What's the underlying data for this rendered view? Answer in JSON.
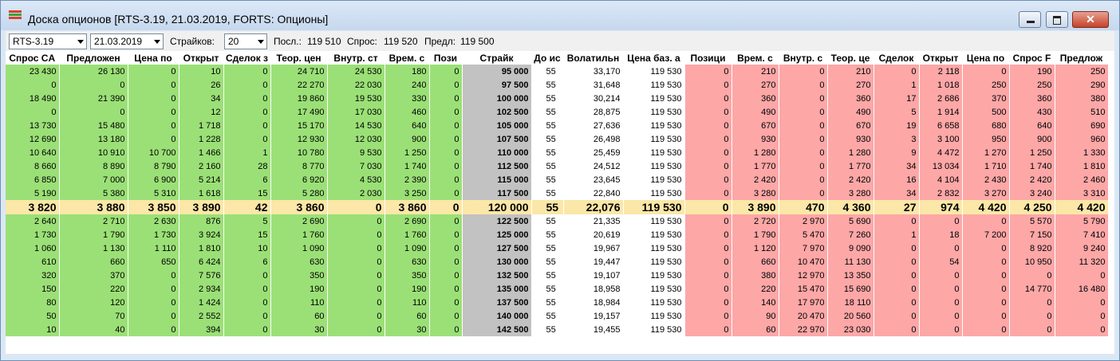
{
  "window": {
    "title": "Доска опционов [RTS-3.19, 21.03.2019, FORTS: Опционы]",
    "controls": {
      "minimize": "",
      "maximize": "",
      "close": "✕"
    }
  },
  "toolbar": {
    "instrument": "RTS-3.19",
    "expiration": "21.03.2019",
    "strikes_label": "Страйков:",
    "strikes_value": "20",
    "last_label": "Посл.:",
    "last_value": "119 510",
    "bid_label": "Спрос:",
    "bid_value": "119 520",
    "ask_label": "Предл:",
    "ask_value": "119 500"
  },
  "colors": {
    "call_bg": "#9be077",
    "put_bg": "#fda7a7",
    "strike_bg": "#c2c2c2",
    "atm_bg": "#fbe7a7"
  },
  "columns": [
    "Спрос CA",
    "Предложен",
    "Цена по",
    "Открыт",
    "Сделок з",
    "Теор. цен",
    "Внутр. ст",
    "Врем. с",
    "Пози",
    "Страйк",
    "До ис",
    "Волатильн",
    "Цена баз. а",
    "Позици",
    "Врем. с",
    "Внутр. с",
    "Теор. це",
    "Сделок",
    "Открыт",
    "Цена по",
    "Спрос F",
    "Предлож"
  ],
  "rows": [
    [
      "23 430",
      "26 130",
      "0",
      "10",
      "0",
      "24 710",
      "24 530",
      "180",
      "0",
      "95 000",
      "55",
      "33,170",
      "119 530",
      "0",
      "210",
      "0",
      "210",
      "0",
      "2 118",
      "0",
      "190",
      "250"
    ],
    [
      "0",
      "0",
      "0",
      "26",
      "0",
      "22 270",
      "22 030",
      "240",
      "0",
      "97 500",
      "55",
      "31,648",
      "119 530",
      "0",
      "270",
      "0",
      "270",
      "1",
      "1 018",
      "250",
      "250",
      "290"
    ],
    [
      "18 490",
      "21 390",
      "0",
      "34",
      "0",
      "19 860",
      "19 530",
      "330",
      "0",
      "100 000",
      "55",
      "30,214",
      "119 530",
      "0",
      "360",
      "0",
      "360",
      "17",
      "2 686",
      "370",
      "360",
      "380"
    ],
    [
      "0",
      "0",
      "0",
      "12",
      "0",
      "17 490",
      "17 030",
      "460",
      "0",
      "102 500",
      "55",
      "28,875",
      "119 530",
      "0",
      "490",
      "0",
      "490",
      "5",
      "1 914",
      "500",
      "430",
      "510"
    ],
    [
      "13 730",
      "15 480",
      "0",
      "1 718",
      "0",
      "15 170",
      "14 530",
      "640",
      "0",
      "105 000",
      "55",
      "27,636",
      "119 530",
      "0",
      "670",
      "0",
      "670",
      "19",
      "6 658",
      "680",
      "640",
      "690"
    ],
    [
      "12 690",
      "13 180",
      "0",
      "1 228",
      "0",
      "12 930",
      "12 030",
      "900",
      "0",
      "107 500",
      "55",
      "26,498",
      "119 530",
      "0",
      "930",
      "0",
      "930",
      "3",
      "3 100",
      "950",
      "900",
      "960"
    ],
    [
      "10 640",
      "10 910",
      "10 700",
      "1 466",
      "1",
      "10 780",
      "9 530",
      "1 250",
      "0",
      "110 000",
      "55",
      "25,459",
      "119 530",
      "0",
      "1 280",
      "0",
      "1 280",
      "9",
      "4 472",
      "1 270",
      "1 250",
      "1 330"
    ],
    [
      "8 660",
      "8 890",
      "8 790",
      "2 160",
      "28",
      "8 770",
      "7 030",
      "1 740",
      "0",
      "112 500",
      "55",
      "24,512",
      "119 530",
      "0",
      "1 770",
      "0",
      "1 770",
      "34",
      "13 034",
      "1 710",
      "1 740",
      "1 810"
    ],
    [
      "6 850",
      "7 000",
      "6 900",
      "5 214",
      "6",
      "6 920",
      "4 530",
      "2 390",
      "0",
      "115 000",
      "55",
      "23,645",
      "119 530",
      "0",
      "2 420",
      "0",
      "2 420",
      "16",
      "4 104",
      "2 430",
      "2 420",
      "2 460"
    ],
    [
      "5 190",
      "5 380",
      "5 310",
      "1 618",
      "15",
      "5 280",
      "2 030",
      "3 250",
      "0",
      "117 500",
      "55",
      "22,840",
      "119 530",
      "0",
      "3 280",
      "0",
      "3 280",
      "34",
      "2 832",
      "3 270",
      "3 240",
      "3 310"
    ],
    [
      "3 820",
      "3 880",
      "3 850",
      "3 890",
      "42",
      "3 860",
      "0",
      "3 860",
      "0",
      "120 000",
      "55",
      "22,076",
      "119 530",
      "0",
      "3 890",
      "470",
      "4 360",
      "27",
      "974",
      "4 420",
      "4 250",
      "4 420"
    ],
    [
      "2 640",
      "2 710",
      "2 630",
      "876",
      "5",
      "2 690",
      "0",
      "2 690",
      "0",
      "122 500",
      "55",
      "21,335",
      "119 530",
      "0",
      "2 720",
      "2 970",
      "5 690",
      "0",
      "0",
      "0",
      "5 570",
      "5 790"
    ],
    [
      "1 730",
      "1 790",
      "1 730",
      "3 924",
      "15",
      "1 760",
      "0",
      "1 760",
      "0",
      "125 000",
      "55",
      "20,619",
      "119 530",
      "0",
      "1 790",
      "5 470",
      "7 260",
      "1",
      "18",
      "7 200",
      "7 150",
      "7 410"
    ],
    [
      "1 060",
      "1 130",
      "1 110",
      "1 810",
      "10",
      "1 090",
      "0",
      "1 090",
      "0",
      "127 500",
      "55",
      "19,967",
      "119 530",
      "0",
      "1 120",
      "7 970",
      "9 090",
      "0",
      "0",
      "0",
      "8 920",
      "9 240"
    ],
    [
      "610",
      "660",
      "650",
      "6 424",
      "6",
      "630",
      "0",
      "630",
      "0",
      "130 000",
      "55",
      "19,447",
      "119 530",
      "0",
      "660",
      "10 470",
      "11 130",
      "0",
      "54",
      "0",
      "10 950",
      "11 320"
    ],
    [
      "320",
      "370",
      "0",
      "7 576",
      "0",
      "350",
      "0",
      "350",
      "0",
      "132 500",
      "55",
      "19,107",
      "119 530",
      "0",
      "380",
      "12 970",
      "13 350",
      "0",
      "0",
      "0",
      "0",
      "0"
    ],
    [
      "150",
      "220",
      "0",
      "2 934",
      "0",
      "190",
      "0",
      "190",
      "0",
      "135 000",
      "55",
      "18,958",
      "119 530",
      "0",
      "220",
      "15 470",
      "15 690",
      "0",
      "0",
      "0",
      "14 770",
      "16 480"
    ],
    [
      "80",
      "120",
      "0",
      "1 424",
      "0",
      "110",
      "0",
      "110",
      "0",
      "137 500",
      "55",
      "18,984",
      "119 530",
      "0",
      "140",
      "17 970",
      "18 110",
      "0",
      "0",
      "0",
      "0",
      "0"
    ],
    [
      "50",
      "70",
      "0",
      "2 552",
      "0",
      "60",
      "0",
      "60",
      "0",
      "140 000",
      "55",
      "19,157",
      "119 530",
      "0",
      "90",
      "20 470",
      "20 560",
      "0",
      "0",
      "0",
      "0",
      "0"
    ],
    [
      "10",
      "40",
      "0",
      "394",
      "0",
      "30",
      "0",
      "30",
      "0",
      "142 500",
      "55",
      "19,455",
      "119 530",
      "0",
      "60",
      "22 970",
      "23 030",
      "0",
      "0",
      "0",
      "0",
      "0"
    ]
  ],
  "atm_row_index": 10
}
